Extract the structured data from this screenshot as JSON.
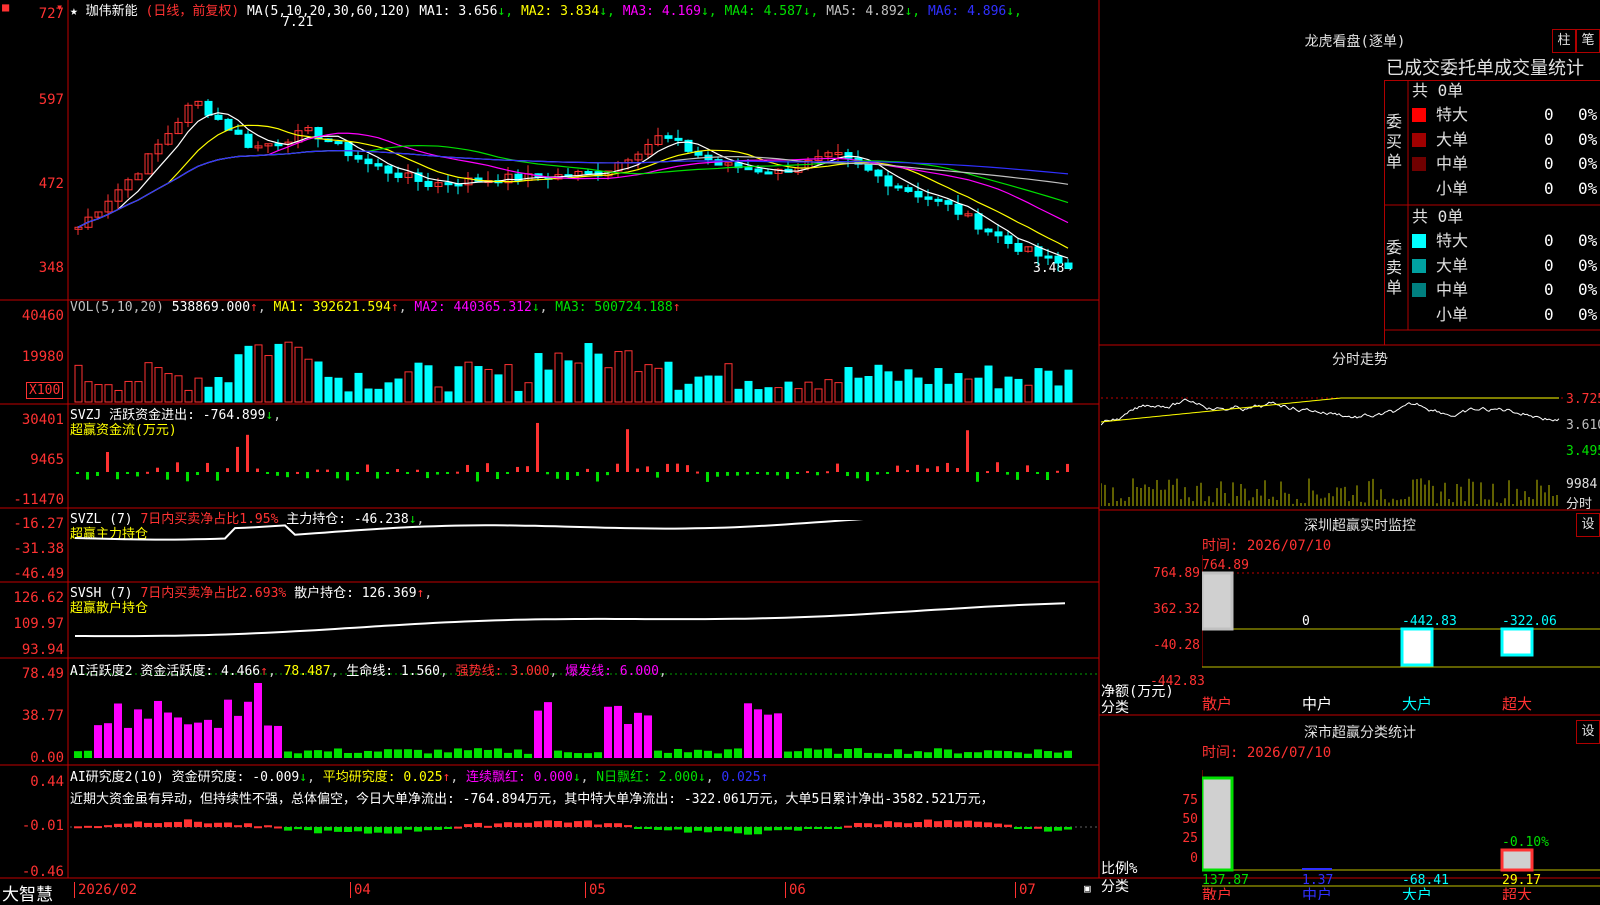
{
  "stock": {
    "name": "珈伟新能",
    "mode": "(日线，前复权)",
    "ma_header": "MA(5,10,20,30,60,120)",
    "ma": [
      {
        "label": "MA1: 3.656",
        "arrow": "↓",
        "color": "#ffffff"
      },
      {
        "label": "MA2: 3.834",
        "arrow": "↓",
        "color": "#ffff00"
      },
      {
        "label": "MA3: 4.169",
        "arrow": "↓",
        "color": "#ff00ff"
      },
      {
        "label": "MA4: 4.587",
        "arrow": "↓",
        "color": "#00e000"
      },
      {
        "label": "MA5: 4.892",
        "arrow": "↓",
        "color": "#c0c0c0"
      },
      {
        "label": "MA6: 4.896",
        "arrow": "↓",
        "color": "#3030ff"
      }
    ],
    "high_marker": "7.21",
    "low_marker": "3.48→"
  },
  "price_axis": [
    "727",
    "597",
    "472",
    "348"
  ],
  "vol": {
    "header": "VOL(5,10,20)",
    "value": "538869.000",
    "ma1": "MA1: 392621.594",
    "ma2": "MA2: 440365.312",
    "ma3": "MA3: 500724.188",
    "axis": [
      "40460",
      "19980"
    ],
    "unit": "X100"
  },
  "svzj": {
    "header": "SVZJ",
    "label": "活跃资金进出: -764.899",
    "sub": "超赢资金流(万元)",
    "axis": [
      "30401",
      "9465",
      "-11470"
    ]
  },
  "svzl": {
    "header": "SVZL (7)",
    "ratio": "7日内买卖净占比1.95%",
    "pos": "主力持仓: -46.238",
    "sub": "超赢主力持仓",
    "axis": [
      "-16.27",
      "-31.38",
      "-46.49"
    ]
  },
  "svsh": {
    "header": "SVSH (7)",
    "ratio": "7日内买卖净占比2.693%",
    "pos": "散户持仓: 126.369",
    "sub": "超赢散户持仓",
    "axis": [
      "126.62",
      "109.97",
      "93.94"
    ]
  },
  "ai1": {
    "header": "AI活跃度2",
    "a": "资金活跃度: 4.466",
    "b": "78.487",
    "c": "生命线: 1.560",
    "d": "强势线: 3.000",
    "e": "爆发线: 6.000",
    "axis": [
      "78.49",
      "38.77",
      "0.00"
    ]
  },
  "ai2": {
    "header": "AI研究度2(10)",
    "a": "资金研究度: -0.009",
    "b": "平均研究度: 0.025",
    "c": "连续飘红: 0.000",
    "d": "N日飘红: 2.000",
    "e": "0.025",
    "comment": "近期大资金虽有异动，但持续性不强，总体偏空，今日大单净流出: -764.894万元，其中特大单净流出: -322.061万元，大单5日累计净出-3582.521万元，",
    "axis": [
      "0.44",
      "-0.01",
      "-0.46"
    ]
  },
  "xaxis": [
    "2026/02",
    "04",
    "05",
    "06",
    "07"
  ],
  "brand": "大智慧",
  "right": {
    "dragon_title": "龙虎看盘(逐单)",
    "btn_a": "柱",
    "btn_b": "笔",
    "tabs": "已成交委托单成交量统计",
    "buy_label": "委买单",
    "sell_label": "委卖单",
    "buy_total": "共 0单",
    "sell_total": "共 0单",
    "buy_rows": [
      {
        "name": "特大",
        "n": "0",
        "p": "0%",
        "color": "#ff0000"
      },
      {
        "name": "大单",
        "n": "0",
        "p": "0%",
        "color": "#a00000"
      },
      {
        "name": "中单",
        "n": "0",
        "p": "0%",
        "color": "#700000"
      },
      {
        "name": "小单",
        "n": "0",
        "p": "0%",
        "color": ""
      }
    ],
    "sell_rows": [
      {
        "name": "特大",
        "n": "0",
        "p": "0%",
        "color": "#00ffff"
      },
      {
        "name": "大单",
        "n": "0",
        "p": "0%",
        "color": "#00a0a0"
      },
      {
        "name": "中单",
        "n": "0",
        "p": "0%",
        "color": "#008080"
      },
      {
        "name": "小单",
        "n": "0",
        "p": "0%",
        "color": ""
      }
    ],
    "intraday_title": "分时走势",
    "intraday_axis": [
      "3.725",
      "3.610",
      "3.495"
    ],
    "intraday_vol": "9984",
    "intraday_unit": "分时",
    "sz_title": "深圳超赢实时监控",
    "sz_btn": "设",
    "sz_time": "时间: 2026/07/10",
    "sz_axis": [
      "764.89",
      "362.32",
      "-40.28",
      "-442.83"
    ],
    "sz_unit": "净额(万元)",
    "sz_class": "分类",
    "sz_values": [
      "764.89",
      "0",
      "-442.83",
      "-322.06"
    ],
    "sz_cats": [
      "散户",
      "中户",
      "大户",
      "超大"
    ],
    "cls_title": "深市超赢分类统计",
    "cls_btn": "设",
    "cls_time": "时间: 2026/07/10",
    "cls_axis": [
      "75",
      "50",
      "25",
      "0"
    ],
    "cls_unit": "比例%",
    "cls_class": "分类",
    "cls_top": "-0.10%",
    "cls_values": [
      "137.87",
      "1.37",
      "-68.41",
      "29.17"
    ],
    "cls_cats": [
      "散户",
      "中户",
      "大户",
      "超大"
    ]
  }
}
